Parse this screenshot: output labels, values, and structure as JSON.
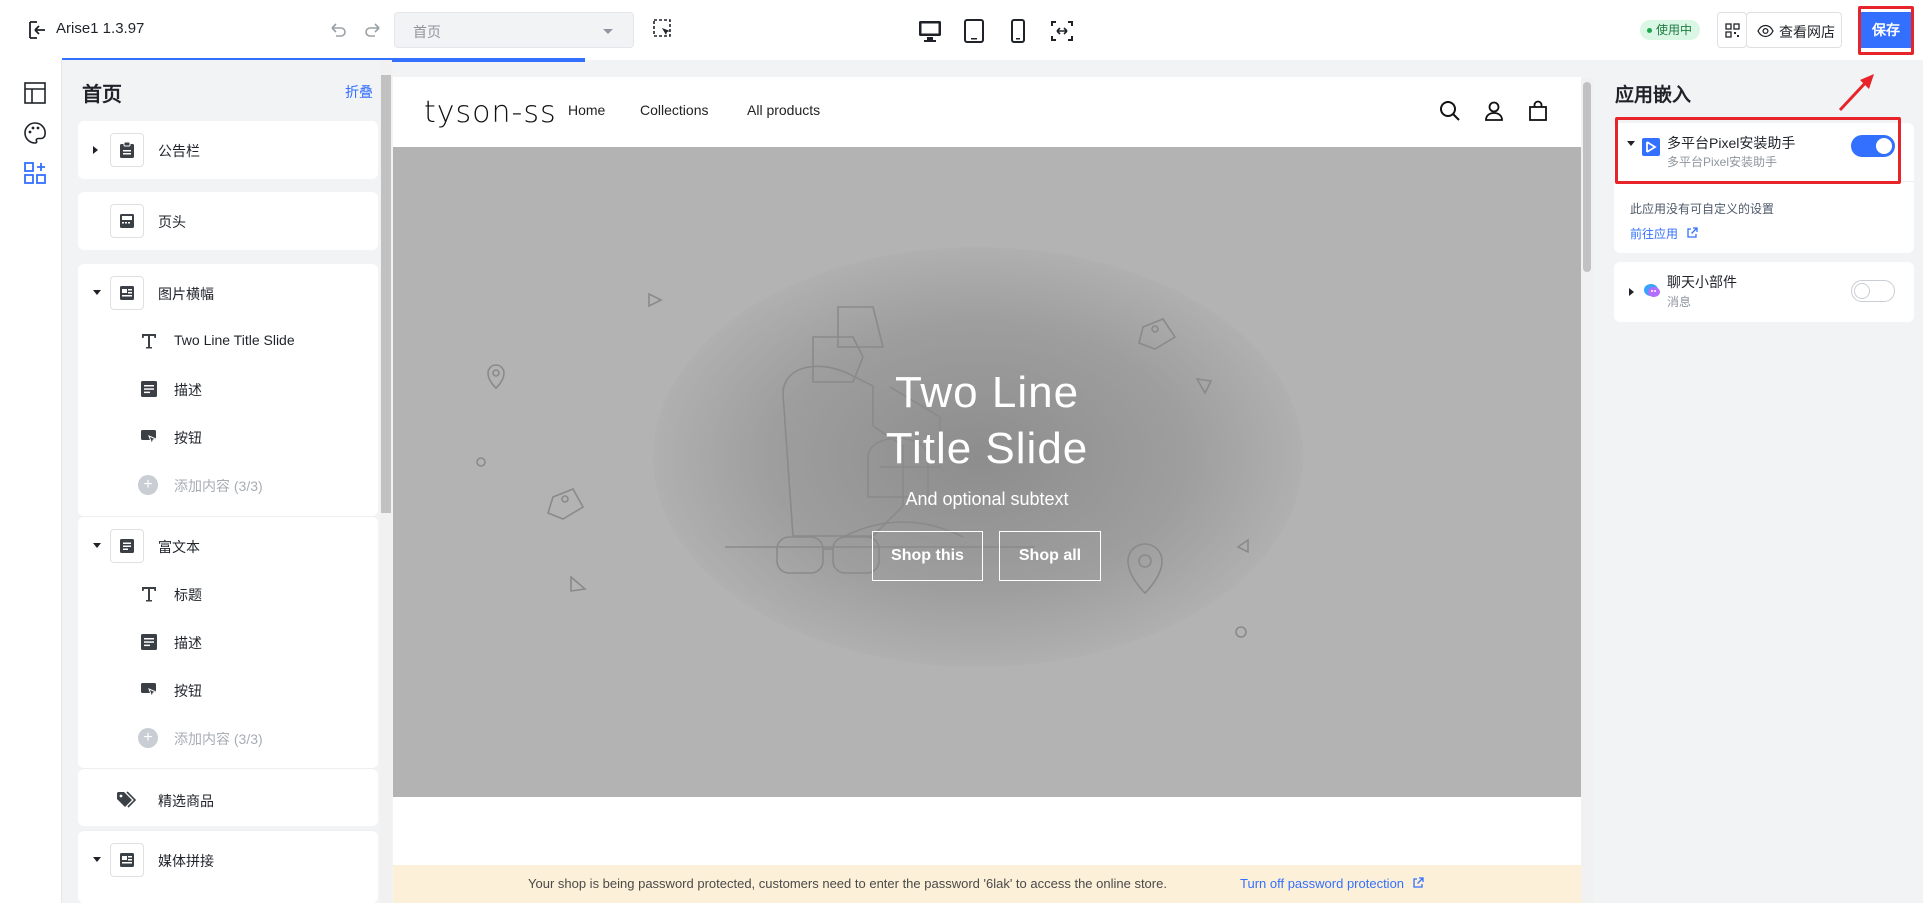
{
  "topbar": {
    "app_title": "Arise1 1.3.97",
    "page_select": "首页",
    "status_badge": "使用中",
    "view_store_label": "查看网店",
    "save_label": "保存",
    "accent_color": "#3370ff"
  },
  "sections_panel": {
    "title": "首页",
    "fold_label": "折叠",
    "items": [
      {
        "label": "公告栏",
        "icon": "announcement-icon"
      },
      {
        "label": "页头",
        "icon": "header-icon"
      },
      {
        "label": "图片横幅",
        "icon": "image-banner-icon",
        "children": [
          {
            "label": "Two Line Title Slide",
            "icon": "text-icon"
          },
          {
            "label": "描述",
            "icon": "paragraph-icon"
          },
          {
            "label": "按钮",
            "icon": "button-icon"
          },
          {
            "label": "添加内容 (3/3)",
            "icon": "add-icon"
          }
        ]
      },
      {
        "label": "富文本",
        "icon": "rich-text-icon",
        "children": [
          {
            "label": "标题",
            "icon": "text-icon"
          },
          {
            "label": "描述",
            "icon": "paragraph-icon"
          },
          {
            "label": "按钮",
            "icon": "button-icon"
          },
          {
            "label": "添加内容 (3/3)",
            "icon": "add-icon"
          }
        ]
      },
      {
        "label": "精选商品",
        "icon": "tags-icon"
      },
      {
        "label": "媒体拼接",
        "icon": "media-icon"
      }
    ]
  },
  "preview": {
    "brand": "tyson-ss",
    "nav": [
      "Home",
      "Collections",
      "All products"
    ],
    "hero_title_line1": "Two Line",
    "hero_title_line2": "Title Slide",
    "hero_subtext": "And optional subtext",
    "button_1": "Shop this",
    "button_2": "Shop all",
    "password_notice": "Your shop is being password protected, customers need to enter the password '6lak' to access the online store.",
    "password_link": "Turn off password protection"
  },
  "app_embeds": {
    "title": "应用嵌入",
    "apps": [
      {
        "name": "多平台Pixel安装助手",
        "subtitle": "多平台Pixel安装助手",
        "enabled": true,
        "no_settings_text": "此应用没有可自定义的设置",
        "go_to_app": "前往应用"
      },
      {
        "name": "聊天小部件",
        "subtitle": "消息",
        "enabled": false
      }
    ]
  }
}
